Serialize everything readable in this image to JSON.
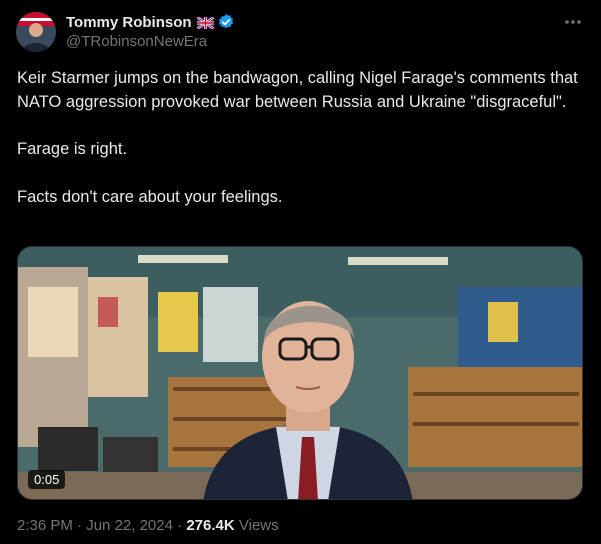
{
  "author": {
    "display_name": "Tommy Robinson",
    "handle": "@TRobinsonNewEra",
    "flag_icon": "uk-flag-icon",
    "verified_icon": "verified-badge-icon",
    "verified_color": "#1d9bf0"
  },
  "tweet": {
    "paragraphs": [
      "Keir Starmer jumps on the bandwagon, calling Nigel Farage's comments that NATO aggression provoked war between Russia and Ukraine \"disgraceful\".",
      "Farage is right.",
      "Facts don't care about your feelings."
    ]
  },
  "video": {
    "duration": "0:05"
  },
  "meta": {
    "time": "2:36 PM",
    "separator": "·",
    "date": "Jun 22, 2024",
    "views_count": "276.4K",
    "views_label": "Views"
  },
  "menu": {
    "more_icon": "more-horizontal-icon"
  }
}
